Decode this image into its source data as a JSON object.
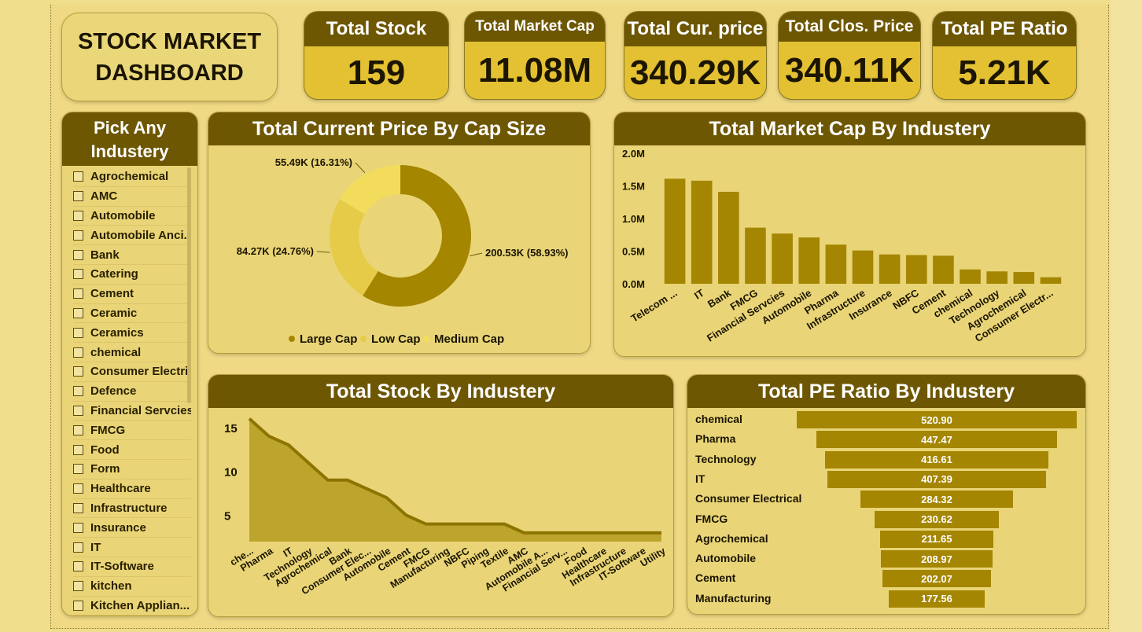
{
  "dashboard": {
    "title_line1": "STOCK MARKET",
    "title_line2": "DASHBOARD"
  },
  "kpis": [
    {
      "label": "Total Stock",
      "value": "159"
    },
    {
      "label": "Total Market Cap",
      "value": "11.08M"
    },
    {
      "label": "Total Cur. price",
      "value": "340.29K"
    },
    {
      "label": "Total Clos. Price",
      "value": "340.11K"
    },
    {
      "label": "Total PE Ratio",
      "value": "5.21K"
    }
  ],
  "slicer": {
    "title": "Pick Any Industery",
    "items": [
      "Agrochemical",
      "AMC",
      "Automobile",
      "Automobile Anci...",
      "Bank",
      "Catering",
      "Cement",
      "Ceramic",
      "Ceramics",
      "chemical",
      "Consumer Electri...",
      "Defence",
      "Financial Servcies",
      "FMCG",
      "Food",
      "Form",
      "Healthcare",
      "Infrastructure",
      "Insurance",
      "IT",
      "IT-Software",
      "kitchen",
      "Kitchen Applian..."
    ]
  },
  "colors": {
    "header": "#6e5703",
    "bar": "#a48603",
    "large_cap": "#a58600",
    "low_cap": "#e6cb48",
    "medium_cap": "#f3dc5c",
    "area": "#bba229"
  },
  "chart_data": [
    {
      "type": "pie",
      "title": "Total Current Price By Cap Size",
      "categories": [
        "Large Cap",
        "Low Cap",
        "Medium Cap"
      ],
      "values": [
        200.53,
        84.27,
        55.49
      ],
      "labels": [
        "200.53K (58.93%)",
        "84.27K (24.76%)",
        "55.49K (16.31%)"
      ],
      "donut": true,
      "legend": "bottom"
    },
    {
      "type": "bar",
      "title": "Total Market Cap By Industery",
      "categories": [
        "Telecom ...",
        "IT",
        "Bank",
        "FMCG",
        "Financial Servcies",
        "Automobile",
        "Pharma",
        "Infrastructure",
        "Insurance",
        "NBFC",
        "Cement",
        "chemical",
        "Technology",
        "Agrochemical",
        "Consumer Electr..."
      ],
      "values": [
        1.61,
        1.58,
        1.41,
        0.86,
        0.77,
        0.71,
        0.6,
        0.51,
        0.45,
        0.44,
        0.43,
        0.22,
        0.19,
        0.18,
        0.1
      ],
      "unit": "M",
      "yticks": [
        "0.0M",
        "0.5M",
        "1.0M",
        "1.5M",
        "2.0M"
      ],
      "ylim": [
        0,
        2
      ]
    },
    {
      "type": "area",
      "title": "Total Stock By Industery",
      "categories": [
        "che...",
        "Pharma",
        "IT",
        "Technology",
        "Agrochemical",
        "Bank",
        "Consumer Elec...",
        "Automobile",
        "Cement",
        "FMCG",
        "Manufacturing",
        "NBFC",
        "Piping",
        "Textile",
        "AMC",
        "Automobile A...",
        "Financial Serv...",
        "Food",
        "Healthcare",
        "Infrastructure",
        "IT-Software",
        "Utility"
      ],
      "values": [
        16,
        14,
        13,
        11,
        9,
        9,
        8,
        7,
        5,
        4,
        4,
        4,
        4,
        4,
        3,
        3,
        3,
        3,
        3,
        3,
        3,
        3
      ],
      "yticks": [
        "5",
        "10",
        "15"
      ],
      "ylim": [
        2,
        16.5
      ]
    },
    {
      "type": "bar",
      "orientation": "funnel",
      "title": "Total PE Ratio By Industery",
      "categories": [
        "chemical",
        "Pharma",
        "Technology",
        "IT",
        "Consumer Electrical",
        "FMCG",
        "Agrochemical",
        "Automobile",
        "Cement",
        "Manufacturing"
      ],
      "values": [
        520.9,
        447.47,
        416.61,
        407.39,
        284.32,
        230.62,
        211.65,
        208.97,
        202.07,
        177.56
      ],
      "labels": [
        "520.90",
        "447.47",
        "416.61",
        "407.39",
        "284.32",
        "230.62",
        "211.65",
        "208.97",
        "202.07",
        "177.56"
      ]
    }
  ]
}
